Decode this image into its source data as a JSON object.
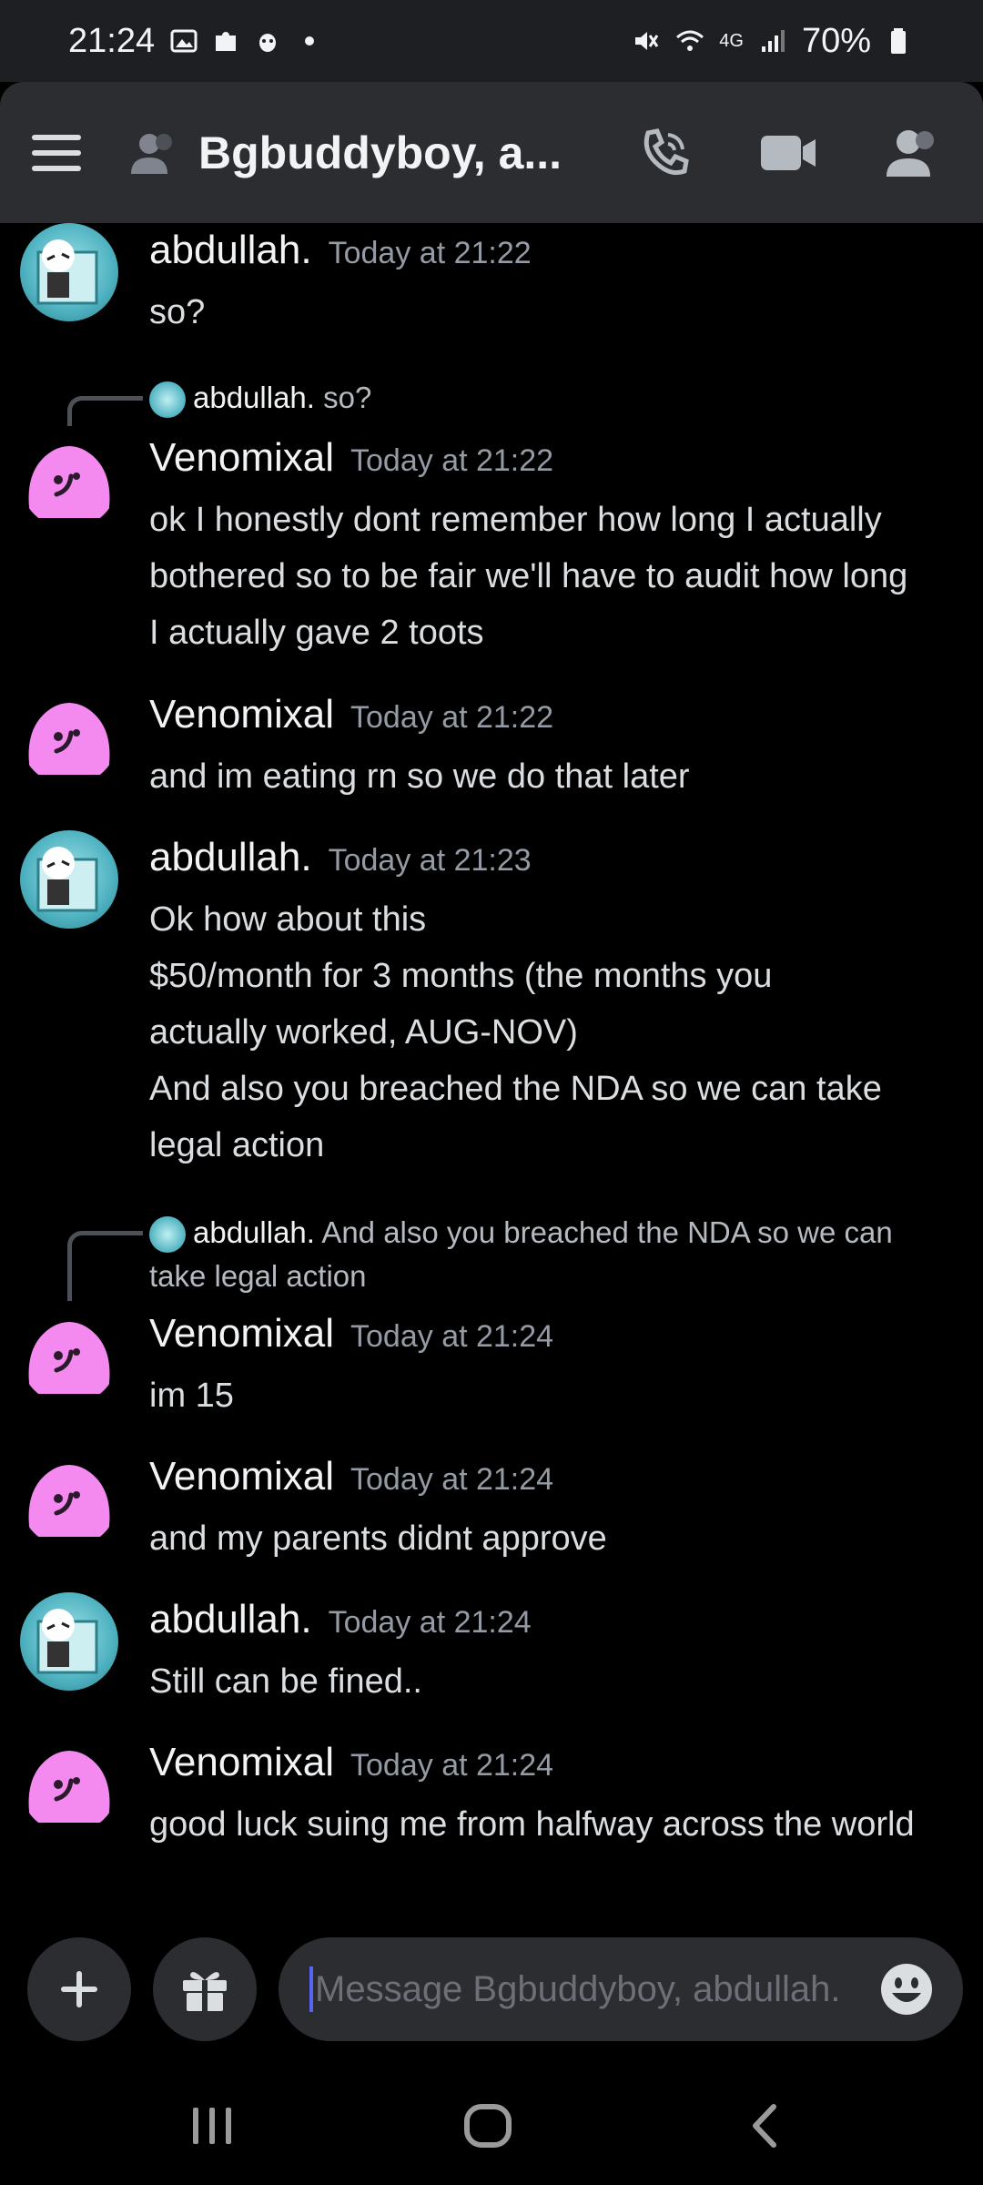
{
  "status_bar": {
    "time": "21:24",
    "battery": "70%",
    "network": "4G",
    "icons_left": [
      "image-icon",
      "puzzle-icon",
      "bug-icon",
      "dot-icon"
    ],
    "icons_right": [
      "mute-vibrate-icon",
      "wifi-icon",
      "4g-icon",
      "signal-icon",
      "battery-icon"
    ]
  },
  "header": {
    "title": "Bgbuddyboy, a...",
    "actions": [
      "call-icon",
      "video-icon",
      "members-icon"
    ]
  },
  "messages": [
    {
      "author": "abdullah.",
      "timestamp": "Today at 21:22",
      "text": [
        "so?"
      ],
      "avatar": "abdullah"
    },
    {
      "author": "Venomixal",
      "timestamp": "Today at 21:22",
      "reply": {
        "author": "abdullah.",
        "text": "so?"
      },
      "text": [
        "ok I honestly dont remember how long I actually",
        "bothered so to be fair we'll have to audit how long",
        "I actually gave 2 toots"
      ],
      "avatar": "venomixal"
    },
    {
      "author": "Venomixal",
      "timestamp": "Today at 21:22",
      "text": [
        "and im eating rn so we do that later"
      ],
      "avatar": "venomixal"
    },
    {
      "author": "abdullah.",
      "timestamp": "Today at 21:23",
      "text": [
        "Ok how about this",
        "$50/month for 3 months (the months you",
        "actually worked, AUG-NOV)",
        "And also you breached the NDA so we can take",
        "legal action"
      ],
      "avatar": "abdullah"
    },
    {
      "author": "Venomixal",
      "timestamp": "Today at 21:24",
      "reply": {
        "author": "abdullah.",
        "text": "And also you breached the NDA so we can",
        "text2": "take legal action"
      },
      "text": [
        "im 15"
      ],
      "avatar": "venomixal"
    },
    {
      "author": "Venomixal",
      "timestamp": "Today at 21:24",
      "text": [
        "and my parents didnt approve"
      ],
      "avatar": "venomixal"
    },
    {
      "author": "abdullah.",
      "timestamp": "Today at 21:24",
      "text": [
        "Still can be fined.."
      ],
      "avatar": "abdullah"
    },
    {
      "author": "Venomixal",
      "timestamp": "Today at 21:24",
      "text": [
        "good luck suing me from halfway across the world"
      ],
      "avatar": "venomixal"
    }
  ],
  "composer": {
    "placeholder": "Message Bgbuddyboy, abdullah.",
    "buttons": [
      "plus-icon",
      "gift-icon",
      "emoji-icon"
    ]
  },
  "navbar": {
    "buttons": [
      "recents-icon",
      "home-icon",
      "back-icon"
    ]
  },
  "colors": {
    "background": "#000000",
    "header": "#2b2d31",
    "venomixal_avatar": "#f48af0",
    "accent": "#5865f2"
  }
}
